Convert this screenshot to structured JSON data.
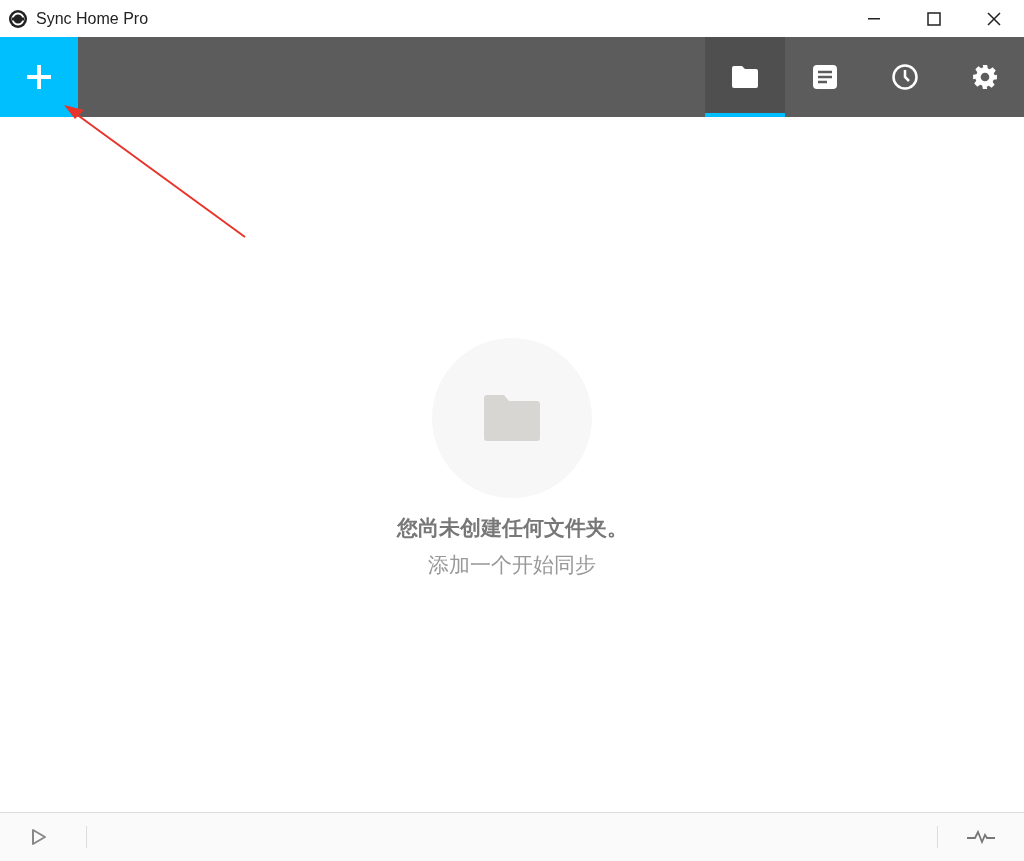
{
  "window": {
    "title": "Sync Home Pro"
  },
  "tabs": [
    {
      "kind": "folders",
      "selected": true
    },
    {
      "kind": "log",
      "selected": false
    },
    {
      "kind": "history",
      "selected": false
    },
    {
      "kind": "settings",
      "selected": false
    }
  ],
  "empty_state": {
    "title": "您尚未创建任何文件夹。",
    "subtitle": "添加一个开始同步"
  }
}
